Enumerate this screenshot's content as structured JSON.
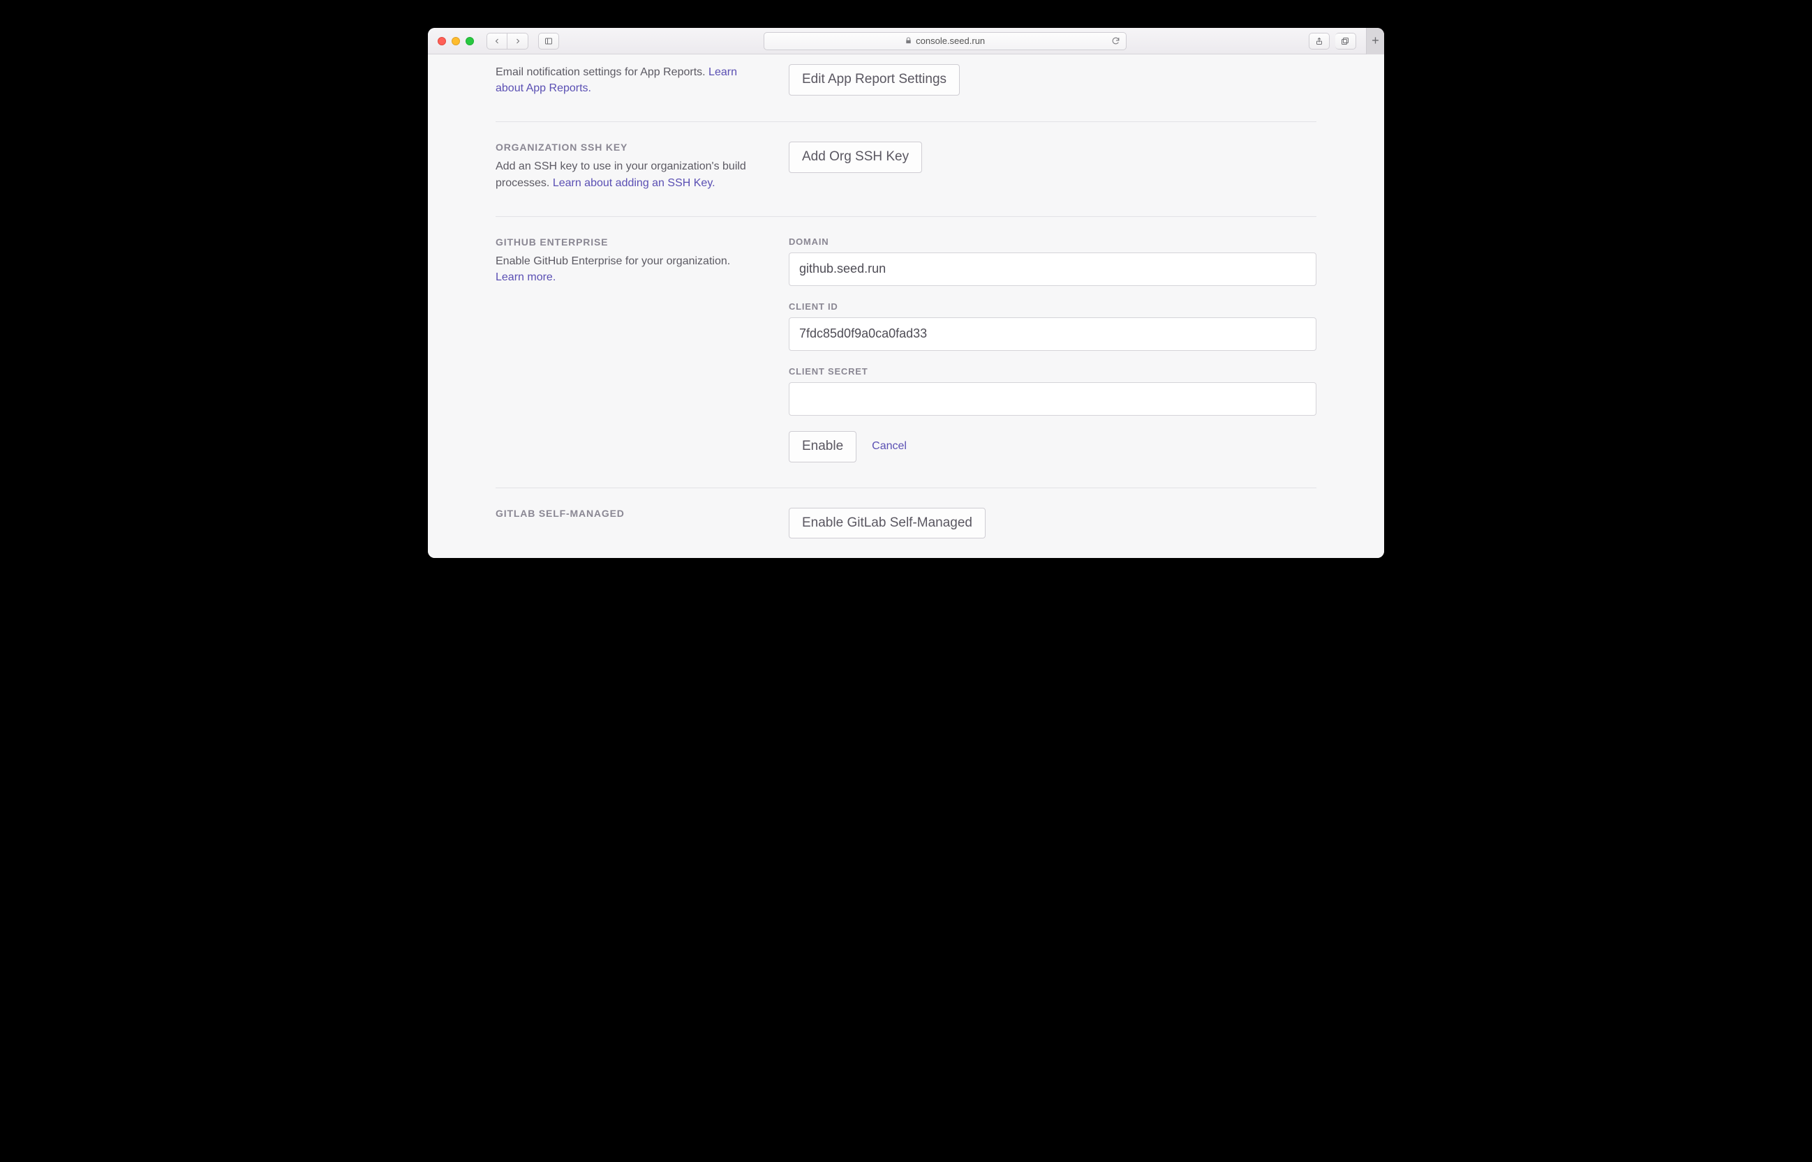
{
  "browser": {
    "url_host": "console.seed.run"
  },
  "sections": {
    "app_reports": {
      "desc_prefix": "Email notification settings for App Reports. ",
      "link": "Learn about App Reports.",
      "button": "Edit App Report Settings"
    },
    "ssh_key": {
      "title": "ORGANIZATION SSH KEY",
      "desc_prefix": "Add an SSH key to use in your organization's build processes. ",
      "link": "Learn about adding an SSH Key.",
      "button": "Add Org SSH Key"
    },
    "github_enterprise": {
      "title": "GITHUB ENTERPRISE",
      "desc_prefix": "Enable GitHub Enterprise for your organization. ",
      "link": "Learn more.",
      "fields": {
        "domain_label": "DOMAIN",
        "domain_value": "github.seed.run",
        "client_id_label": "CLIENT ID",
        "client_id_value": "7fdc85d0f9a0ca0fad33",
        "client_secret_label": "CLIENT SECRET",
        "client_secret_value": ""
      },
      "enable_button": "Enable",
      "cancel": "Cancel"
    },
    "gitlab": {
      "title": "GITLAB SELF-MANAGED",
      "button": "Enable GitLab Self-Managed"
    }
  }
}
